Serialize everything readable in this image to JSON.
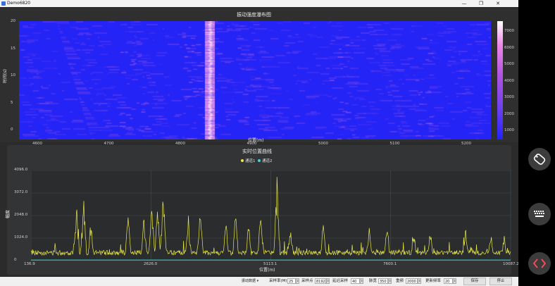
{
  "window": {
    "title": "Demo6820"
  },
  "waterfall": {
    "title": "振动强度瀑布图",
    "xlabel": "位置(m)",
    "ylabel": "时间(s)",
    "x_ticks": [
      "4600",
      "4700",
      "4800",
      "4900",
      "5000",
      "5100",
      "5200"
    ],
    "y_ticks": [
      "20",
      "15",
      "10",
      "5",
      "0"
    ],
    "colorbar_ticks": [
      "7000",
      "6000",
      "5000",
      "4000",
      "3000",
      "2000",
      "1000"
    ],
    "colors": {
      "low": "#2222ff",
      "high": "#ffe0ff"
    }
  },
  "chart_data": {
    "type": "line",
    "title": "实时位置曲线",
    "xlabel": "位置(m)",
    "ylabel": "幅度",
    "x_ticks": [
      "136.9",
      "2626.0",
      "5113.1",
      "7600.1",
      "10087.2"
    ],
    "y_ticks": [
      "4096.0",
      "3072.0",
      "2048.0",
      "1024.0",
      "0"
    ],
    "xlim": [
      136.9,
      10087.2
    ],
    "ylim": [
      0,
      4096
    ],
    "series": [
      {
        "name": "通道1",
        "color": "#e8e84a",
        "baseline": 250,
        "peaks": [
          [
            1082,
            2580
          ],
          [
            1230,
            2850
          ],
          [
            1380,
            1980
          ],
          [
            2150,
            2300
          ],
          [
            2480,
            2100
          ],
          [
            2640,
            2850
          ],
          [
            2760,
            2450
          ],
          [
            2880,
            3300
          ],
          [
            3400,
            2100
          ],
          [
            3650,
            2550
          ],
          [
            4180,
            1950
          ],
          [
            4380,
            2300
          ],
          [
            4650,
            1900
          ],
          [
            4900,
            2050
          ],
          [
            5240,
            3850
          ],
          [
            5520,
            1800
          ],
          [
            6200,
            1850
          ],
          [
            7150,
            1600
          ],
          [
            7520,
            2050
          ],
          [
            8080,
            1400
          ],
          [
            8420,
            1450
          ],
          [
            9150,
            1650
          ],
          [
            9680,
            1450
          ],
          [
            9950,
            1200
          ]
        ]
      },
      {
        "name": "通道2",
        "color": "#3fd6d6",
        "baseline": 30
      }
    ]
  },
  "toolbar": {
    "mode_select": "振动数据",
    "sample_rate_label": "采样率(M)",
    "sample_rate_value": "25",
    "sample_points_label": "采样点",
    "sample_points_value": "8192",
    "delay_label": "延迟采样",
    "delay_value": "40",
    "pulse_width_label": "脉宽",
    "pulse_width_value": "350",
    "repeat_label": "重频",
    "repeat_value": "2000",
    "refresh_label": "更新频率",
    "refresh_value": "20",
    "save_label": "保存",
    "stop_label": "停止"
  }
}
